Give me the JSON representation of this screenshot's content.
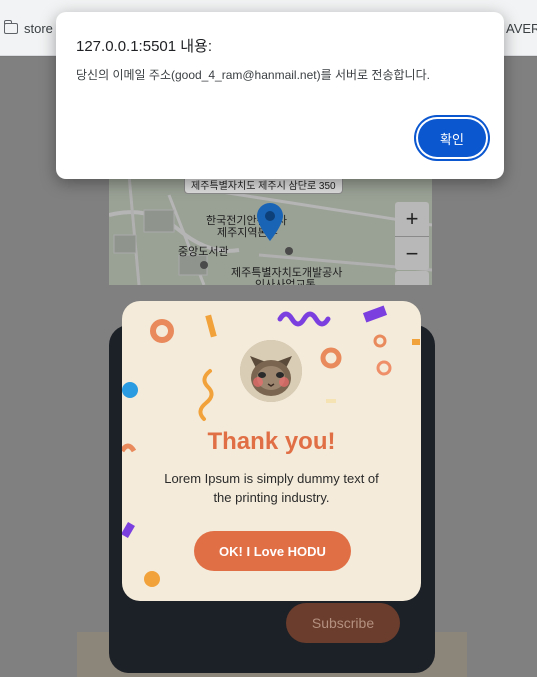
{
  "bookmarks": {
    "store_label": "store",
    "naver_label": "AVER"
  },
  "map": {
    "top_badge": "제주특별자치도 제주시 삼단로 350",
    "labels": {
      "kepco_line1": "한국전기안전공사",
      "kepco_line2": "제주지역본부",
      "library": "중앙도서관",
      "dev_line1": "제주특별자치도개발공사",
      "dev_line2": "인사사업교통"
    },
    "zoom_in": "+",
    "zoom_out": "−"
  },
  "modal": {
    "title": "Thank you!",
    "body": "Lorem Ipsum is simply dummy text of the printing industry.",
    "ok_button": "OK! I Love HODU",
    "avatar_icon": "cat-avatar-icon"
  },
  "subscribe": {
    "label": "Subscribe"
  },
  "alert": {
    "title": "127.0.0.1:5501 내용:",
    "message": "당신의 이메일 주소(good_4_ram@hanmail.net)를 서버로 전송합니다.",
    "ok_label": "확인"
  },
  "colors": {
    "accent": "#e16f46",
    "dialog_button": "#0b57d0",
    "modal_bg": "#f4ebda",
    "dark_card": "#1c2027"
  }
}
